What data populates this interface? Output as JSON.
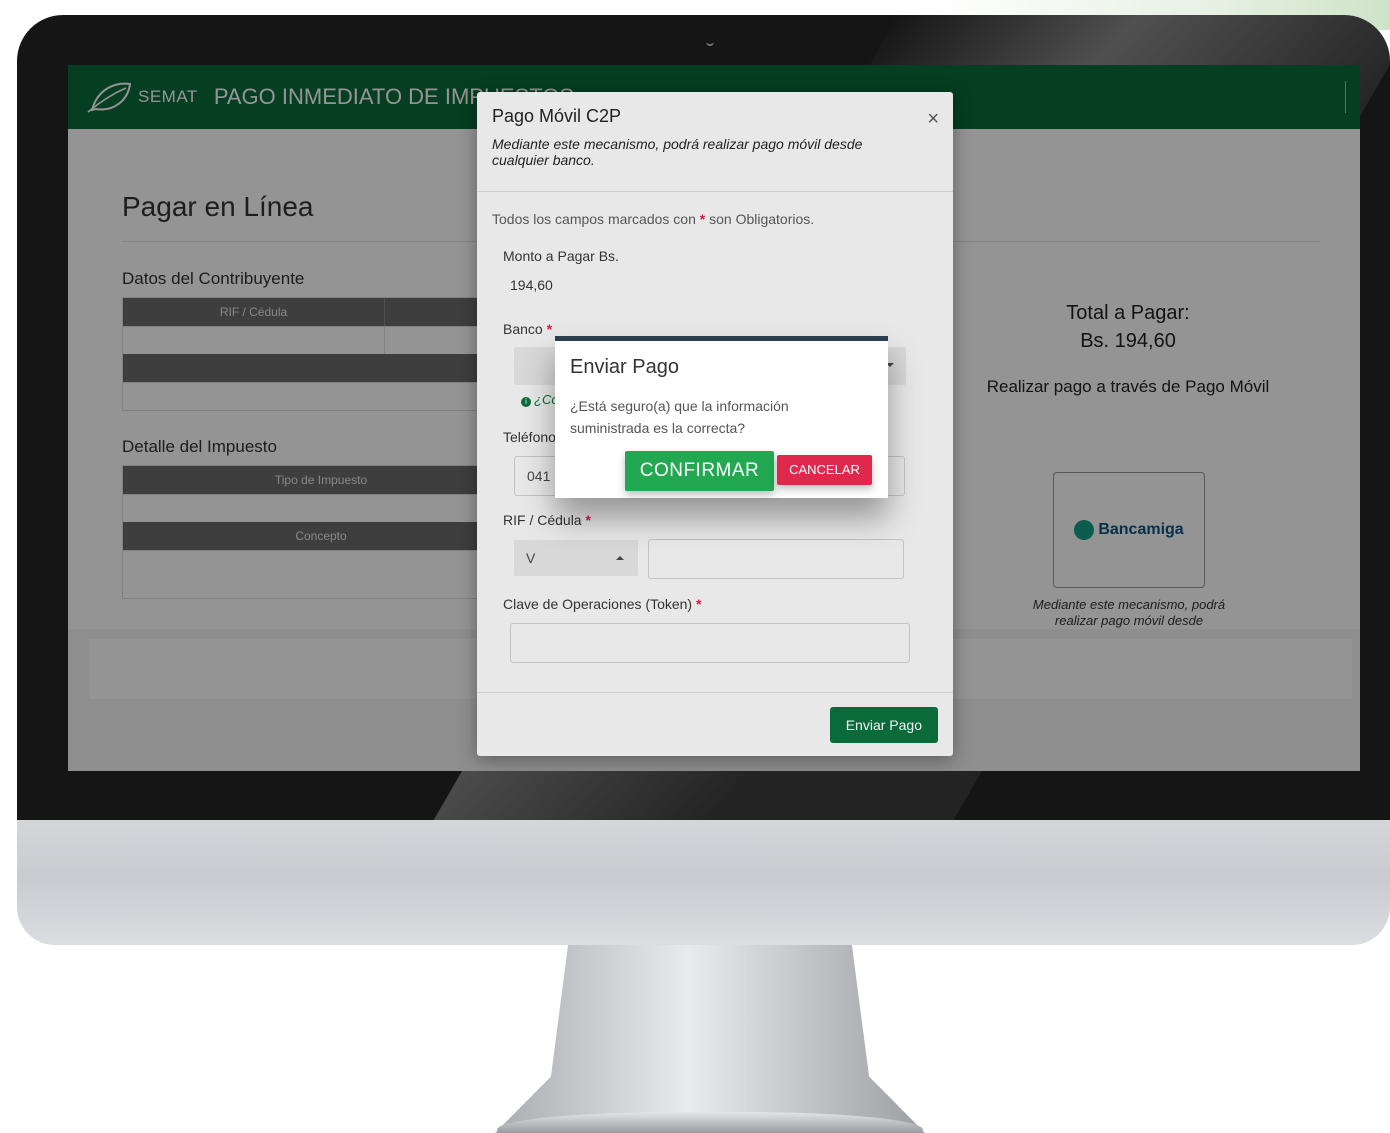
{
  "header": {
    "brand": "SEMAT",
    "title": "PAGO INMEDIATO DE IMPUESTOS"
  },
  "page": {
    "title": "Pagar en Línea",
    "contribuyente": {
      "section_title": "Datos del Contribuyente",
      "columns": [
        "RIF / Cédula",
        ""
      ]
    },
    "impuesto": {
      "section_title": "Detalle del Impuesto",
      "col_tipo": "Tipo de Impuesto",
      "col_concepto": "Concepto"
    },
    "summary": {
      "total_label": "Total a Pagar:",
      "total_amount": "Bs. 194,60",
      "method_title": "Realizar pago a través de Pago Móvil",
      "bank_name": "Bancamiga",
      "method_description": "Mediante este mecanismo, podrá realizar pago móvil desde cualquier banco."
    }
  },
  "modal": {
    "title": "Pago Móvil C2P",
    "subtitle": "Mediante este mecanismo, podrá realizar pago móvil desde cualquier banco.",
    "close_label": "×",
    "required_note_prefix": "Todos los campos marcados con",
    "required_note_suffix": "son Obligatorios.",
    "required_mark": "*",
    "monto_label": "Monto a Pagar Bs.",
    "monto_value": "194,60",
    "banco_label": "Banco",
    "banco_hint": "¿Co",
    "telefono_label": "Teléfono",
    "telefono_value": "041",
    "rif_label": "RIF / Cédula",
    "rif_type": "V",
    "rif_value": "",
    "token_label": "Clave de Operaciones (Token)",
    "token_value": "",
    "submit_label": "Enviar Pago"
  },
  "confirm_dialog": {
    "title": "Enviar Pago",
    "message": "¿Está seguro(a) que la información suministrada es la correcta?",
    "confirm_label": "CONFIRMAR",
    "cancel_label": "CANCELAR"
  },
  "colors": {
    "brand_green": "#0a6b3a",
    "confirm_green": "#22a851",
    "cancel_red": "#e0284c",
    "required_red": "#d81b3c"
  }
}
